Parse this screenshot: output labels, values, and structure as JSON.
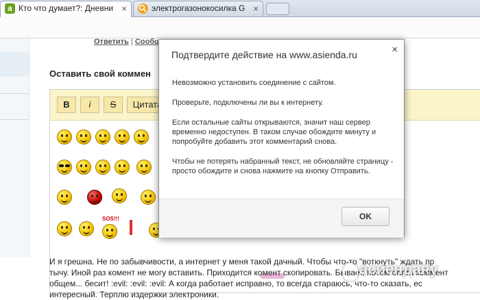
{
  "tabs": [
    {
      "title": "Кто что думает?: Дневни",
      "favicon_letter": "a",
      "color": "#6aa121",
      "active": true
    },
    {
      "title": "электрогазонокосилка G",
      "favicon_letter": "",
      "color": "#f0a020",
      "active": false
    }
  ],
  "page": {
    "reply_link": "Ответить",
    "reply_sep": "|",
    "reply_link2": "Сообщ",
    "comment_heading": "Оставить свой коммен",
    "format_buttons": [
      "B",
      "i",
      "S",
      "Цитата"
    ],
    "sos_label": "SOS!!!",
    "comment_lines": [
      "И я грешна. Не по забывчивости, а интернет у меня такой дачный. Чтобы что-то \"воткнуть\" ждать пр",
      "тычу. Иной раз комент не могу вставить. Приходится комент скопировать. Бывает, потом опять коммент",
      "общем... бесит!  :evil:  :evil:  :evil: А когда работает исправно, то всегда стараюсь, что-то сказать, ес",
      "интересный. Терплю издержки электроники."
    ],
    "watermark": "асиендаʀу"
  },
  "dialog": {
    "title": "Подтвердите действие на www.asienda.ru",
    "close_glyph": "×",
    "paragraphs": [
      "Невозможно установить соединение с сайтом.",
      "Проверьте, подключены ли вы к интернету.",
      "Если остальные сайты открываются, значит наш сервер временно недоступен. В таком случае обождите минуту и попробуйте добавить этот комментарий снова.",
      "Чтобы не потерять набранный текст, не обновляйте страницу - просто обождите и снова нажмите на кнопку Отправить."
    ],
    "ok_label": "OK"
  }
}
